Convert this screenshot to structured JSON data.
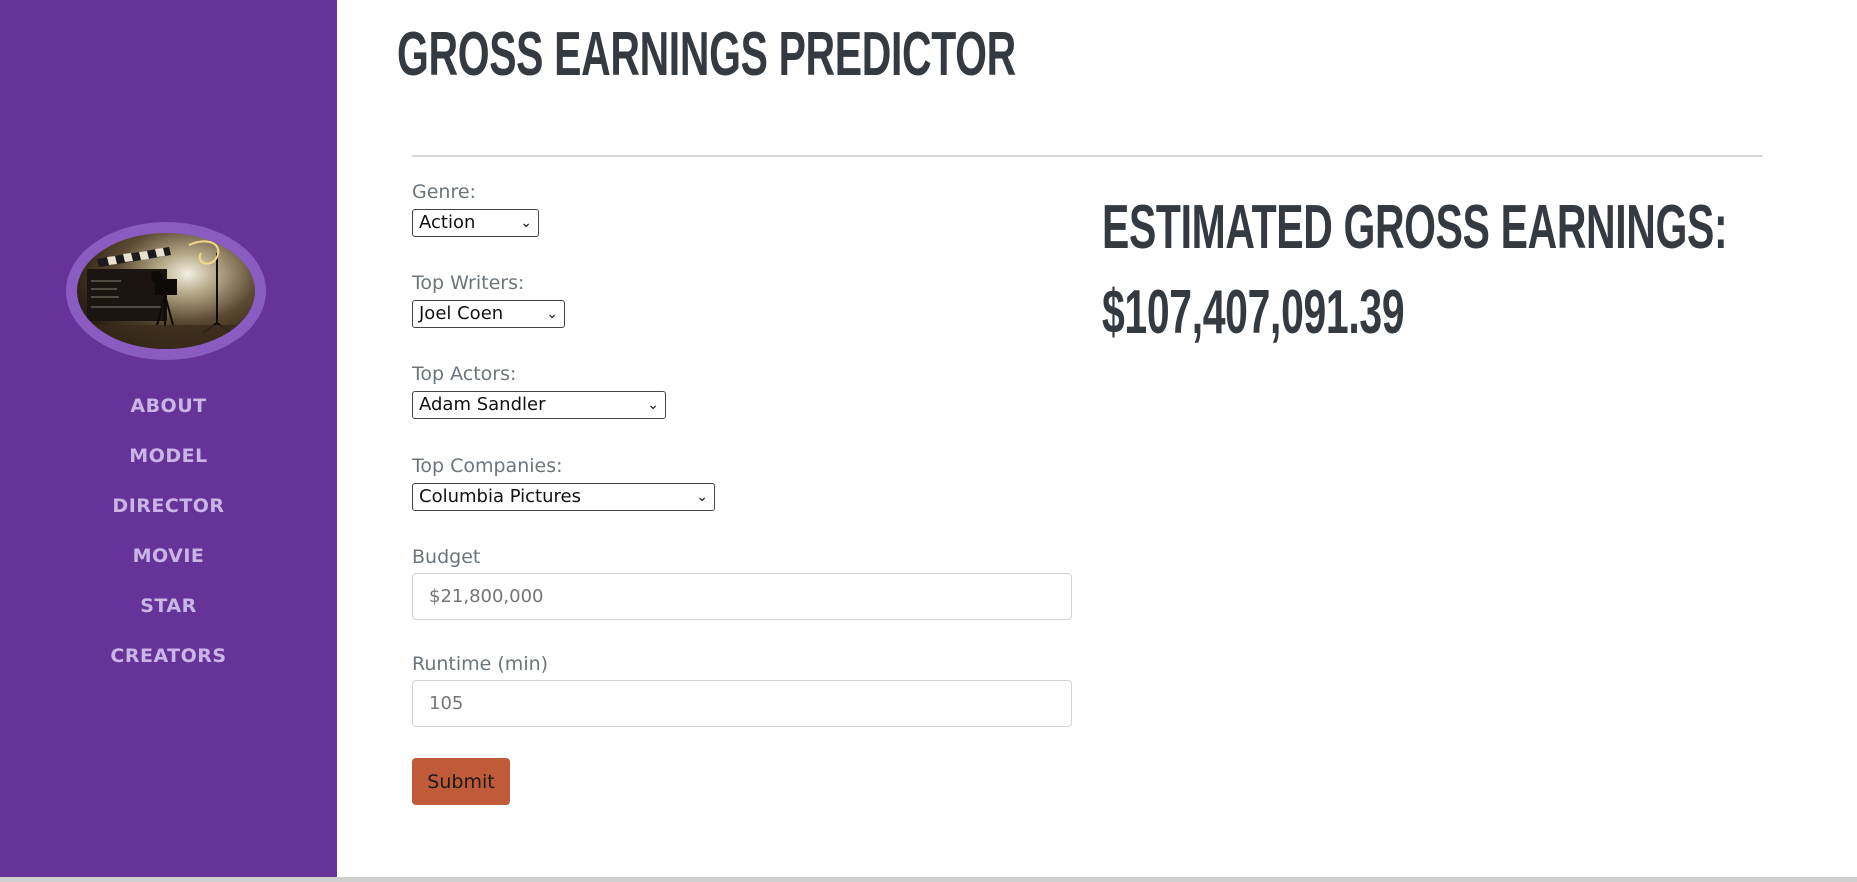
{
  "page": {
    "title": "GROSS EARNINGS PREDICTOR"
  },
  "sidebar": {
    "background": "#663399",
    "nav": [
      {
        "label": "ABOUT"
      },
      {
        "label": "MODEL"
      },
      {
        "label": "DIRECTOR"
      },
      {
        "label": "MOVIE"
      },
      {
        "label": "STAR"
      },
      {
        "label": "CREATORS"
      }
    ]
  },
  "form": {
    "genre": {
      "label": "Genre:",
      "selected": "Action"
    },
    "writers": {
      "label": "Top Writers:",
      "selected": "Joel Coen"
    },
    "actors": {
      "label": "Top Actors:",
      "selected": "Adam Sandler"
    },
    "companies": {
      "label": "Top Companies:",
      "selected": "Columbia Pictures"
    },
    "budget": {
      "label": "Budget",
      "placeholder": "$21,800,000"
    },
    "runtime": {
      "label": "Runtime (min)",
      "placeholder": "105"
    },
    "submit_label": "Submit",
    "submit_color": "#bf5b38"
  },
  "result": {
    "heading": "ESTIMATED GROSS EARNINGS:",
    "value": "$107,407,091.39"
  },
  "icons": {
    "logo": "film-camera-clapperboard-logo",
    "dropdown": "chevron-down-icon"
  }
}
